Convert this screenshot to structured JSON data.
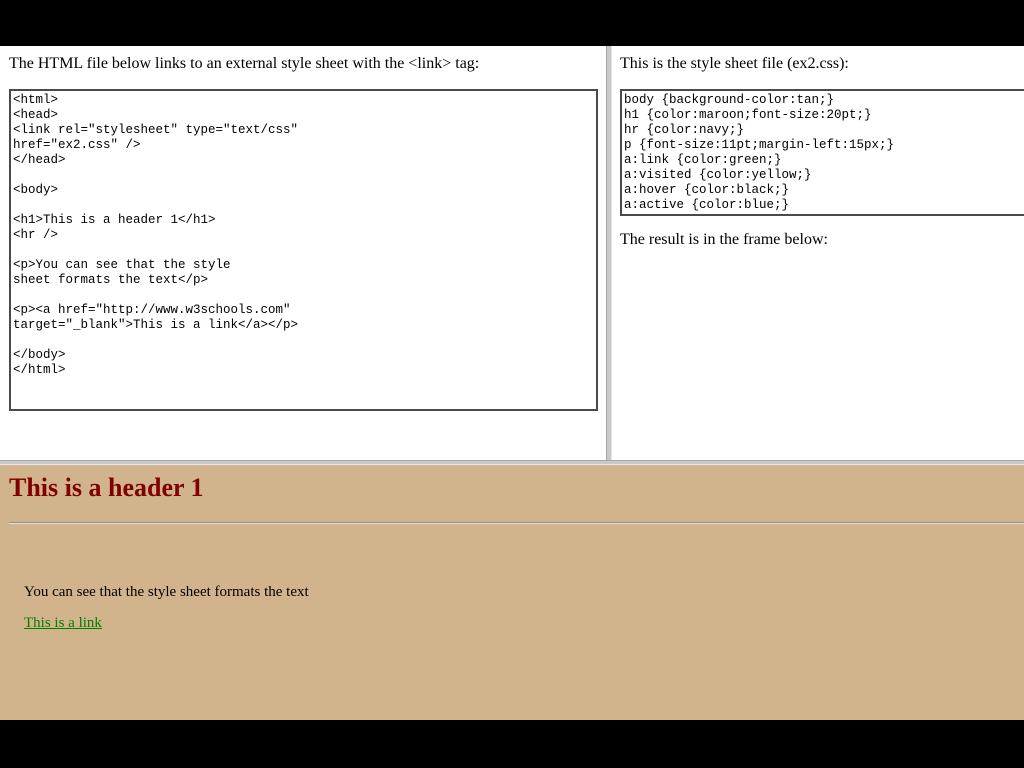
{
  "left_frame": {
    "intro": "The HTML file below links to an external style sheet with the <link> tag:",
    "code": "<html>\n<head>\n<link rel=\"stylesheet\" type=\"text/css\"\nhref=\"ex2.css\" />\n</head>\n\n<body>\n\n<h1>This is a header 1</h1>\n<hr />\n\n<p>You can see that the style\nsheet formats the text</p>\n\n<p><a href=\"http://www.w3schools.com\"\ntarget=\"_blank\">This is a link</a></p>\n\n</body>\n</html>"
  },
  "right_frame": {
    "intro": "This is the style sheet file (ex2.css):",
    "code": "body {background-color:tan;}\nh1 {color:maroon;font-size:20pt;}\nhr {color:navy;}\np {font-size:11pt;margin-left:15px;}\na:link {color:green;}\na:visited {color:yellow;}\na:hover {color:black;}\na:active {color:blue;}",
    "result_label": "The result is in the frame below:"
  },
  "result_frame": {
    "heading": "This is a header 1",
    "paragraph": "You can see that the style sheet formats the text",
    "link_text": "This is a link"
  },
  "colors": {
    "result_background": "#d2b48c",
    "heading": "#800000",
    "link": "#008000"
  }
}
